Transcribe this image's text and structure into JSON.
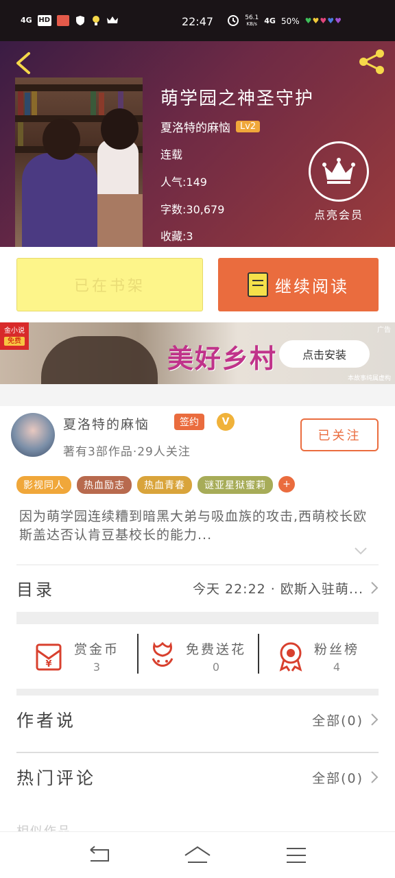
{
  "status_bar": {
    "time": "22:47",
    "net_left": "4G",
    "hd": "HD",
    "speed": "56.1",
    "speed_unit": "KB/s",
    "net_right": "4G",
    "battery": "50%"
  },
  "header": {
    "title": "萌学园之神圣守护",
    "author": "夏洛特的麻恼",
    "level": "Lv2",
    "status": "连载",
    "popularity": "人气:149",
    "word_count": "字数:30,679",
    "favorites": "收藏:3",
    "vip_label": "点亮会员"
  },
  "actions": {
    "shelf_label": "已在书架",
    "read_label": "继续阅读"
  },
  "ad": {
    "logo_text": "金小说",
    "logo_sub": "免费",
    "title": "美好乡村",
    "button": "点击安装",
    "tag": "广告",
    "footnote": "本故事纯属虚构"
  },
  "author_card": {
    "name": "夏洛特的麻恼",
    "signed": "签约",
    "verified": "V",
    "stats": "著有3部作品·29人关注",
    "follow": "已关注"
  },
  "tags": [
    {
      "label": "影视同人",
      "color": "#f0a73a"
    },
    {
      "label": "热血励志",
      "color": "#b86a4e"
    },
    {
      "label": "热血青春",
      "color": "#d9a43b"
    },
    {
      "label": "谜亚星狱蜜莉",
      "color": "#a7ac58"
    }
  ],
  "tag_more": "+",
  "description": "因为萌学园连续糟到暗黑大弟与吸血族的攻击,西萌校长欧斯盖达否认肯豆基校长的能力...",
  "toc": {
    "title": "目录",
    "latest": "今天 22:22 · 欧斯入驻萌..."
  },
  "stats": [
    {
      "label": "赏金币",
      "value": "3",
      "icon": "reward-coin-icon"
    },
    {
      "label": "免费送花",
      "value": "0",
      "icon": "flower-icon"
    },
    {
      "label": "粉丝榜",
      "value": "4",
      "icon": "medal-icon"
    }
  ],
  "author_says": {
    "title": "作者说",
    "right": "全部(0)"
  },
  "hot_comments": {
    "title": "热门评论",
    "right": "全部(0)"
  },
  "similar": "相似作品",
  "colors": {
    "accent": "#ea6c3e",
    "shelf_bg": "#fdf58a"
  }
}
